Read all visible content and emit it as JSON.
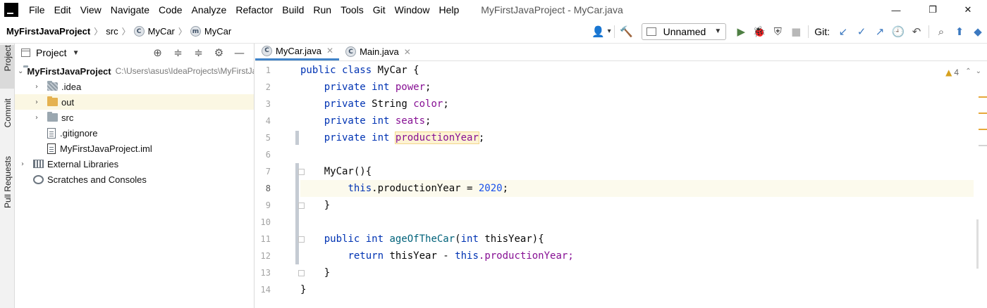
{
  "menu": {
    "items": [
      "File",
      "Edit",
      "View",
      "Navigate",
      "Code",
      "Analyze",
      "Refactor",
      "Build",
      "Run",
      "Tools",
      "Git",
      "Window",
      "Help"
    ],
    "window_title": "MyFirstJavaProject - MyCar.java",
    "minimize_glyph": "—",
    "maximize_glyph": "❐",
    "close_glyph": "✕"
  },
  "navbar": {
    "project": "MyFirstJavaProject",
    "folder": "src",
    "class_badge": "C",
    "class_name": "MyCar",
    "method_badge": "m",
    "method_name": "MyCar",
    "run_config": "Unnamed",
    "git_label": "Git:",
    "icons": {
      "user": "👤",
      "build": "🔨",
      "run": "▶",
      "debug": "🐞",
      "coverage": "⛨",
      "stop": "■",
      "git_update": "↙",
      "git_commit": "✓",
      "git_push": "↗",
      "history": "🕘",
      "rollback": "↶",
      "search": "⌕",
      "upgrade": "⬆",
      "ide_logo": "◆"
    }
  },
  "tool_strip": {
    "project": "Project",
    "commit": "Commit",
    "pull_requests": "Pull Requests"
  },
  "project_panel": {
    "title": "Project",
    "tools": [
      "⊕",
      "≑",
      "≑",
      "⚙",
      "—"
    ],
    "tree": [
      {
        "label": "MyFirstJavaProject",
        "path": "C:\\Users\\asus\\IdeaProjects\\MyFirstJavaProject",
        "arrow": "⌄"
      },
      {
        "label": ".idea",
        "arrow": "›"
      },
      {
        "label": "out",
        "arrow": "›"
      },
      {
        "label": "src",
        "arrow": "›"
      },
      {
        "label": ".gitignore"
      },
      {
        "label": "MyFirstJavaProject.iml"
      },
      {
        "label": "External Libraries",
        "arrow": "›"
      },
      {
        "label": "Scratches and Consoles"
      }
    ]
  },
  "editor": {
    "tabs": [
      {
        "label": "MyCar.java",
        "badge": "C"
      },
      {
        "label": "Main.java",
        "badge": "C"
      }
    ],
    "close_glyph": "✕",
    "warning_count": "4",
    "warning_glyph": "▲",
    "nav_up": "⌃",
    "nav_down": "⌄",
    "line_numbers": [
      "1",
      "2",
      "3",
      "4",
      "5",
      "6",
      "7",
      "8",
      "9",
      "10",
      "11",
      "12",
      "13",
      "14"
    ],
    "code": {
      "l1_kw": "public class",
      "l1_rest": " MyCar {",
      "l2_kw": "private int",
      "l2_field": "power",
      "l3_kw": "private",
      "l3_type": "String",
      "l3_field": "color",
      "l4_kw": "private int",
      "l4_field": "seats",
      "l5_kw": "private int",
      "l5_field": "productionYear",
      "l7_text": "MyCar(){",
      "l8_kw": "this",
      "l8_mid": ".productionYear = ",
      "l8_num": "2020",
      "l9_text": "}",
      "l11_kw1": "public int",
      "l11_name": "ageOfTheCar",
      "l11_paren": "(",
      "l11_kw2": "int",
      "l11_param": "thisYear){",
      "l12_kw": "return",
      "l12_mid": "thisYear - ",
      "l12_kw2": "this",
      "l12_rest": ".productionYear;",
      "l13_text": "}",
      "l14_text": "}",
      "semicolon": ";"
    }
  }
}
